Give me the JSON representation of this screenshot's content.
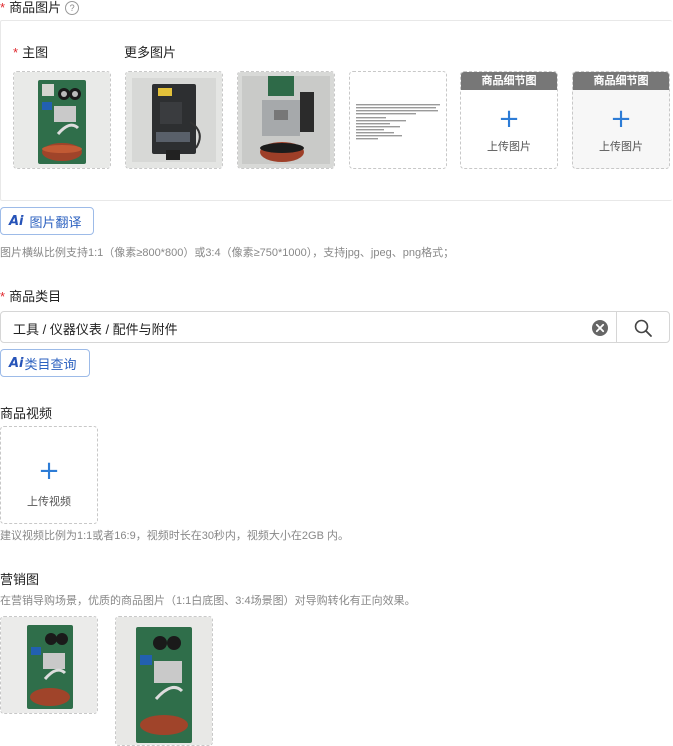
{
  "images_section": {
    "label": "商品图片",
    "help_icon": "?",
    "main_label": "主图",
    "more_label": "更多图片",
    "detail_header": "商品细节图",
    "upload_label": "上传图片",
    "plus": "+",
    "ai_logo": "Ai",
    "ai_translate": "图片翻译",
    "hint": "图片横纵比例支持1:1（像素≥800*800）或3:4（像素≥750*1000），支持jpg、jpeg、png格式；"
  },
  "category_section": {
    "label": "商品类目",
    "value": "工具 / 仪器仪表 / 配件与附件",
    "ai_logo": "Ai",
    "ai_query": "类目查询"
  },
  "video_section": {
    "label": "商品视频",
    "plus": "+",
    "upload_label": "上传视频",
    "hint": "建议视频比例为1:1或者16:9，视频时长在30秒内，视频大小在2GB 内。"
  },
  "marketing_section": {
    "label": "营销图",
    "hint": "在营销导购场景，优质的商品图片（1:1白底图、3:4场景图）对导购转化有正向效果。"
  },
  "colors": {
    "required": "#e0282e",
    "accent": "#2d7cd6",
    "detail_header_bg": "#777777"
  }
}
